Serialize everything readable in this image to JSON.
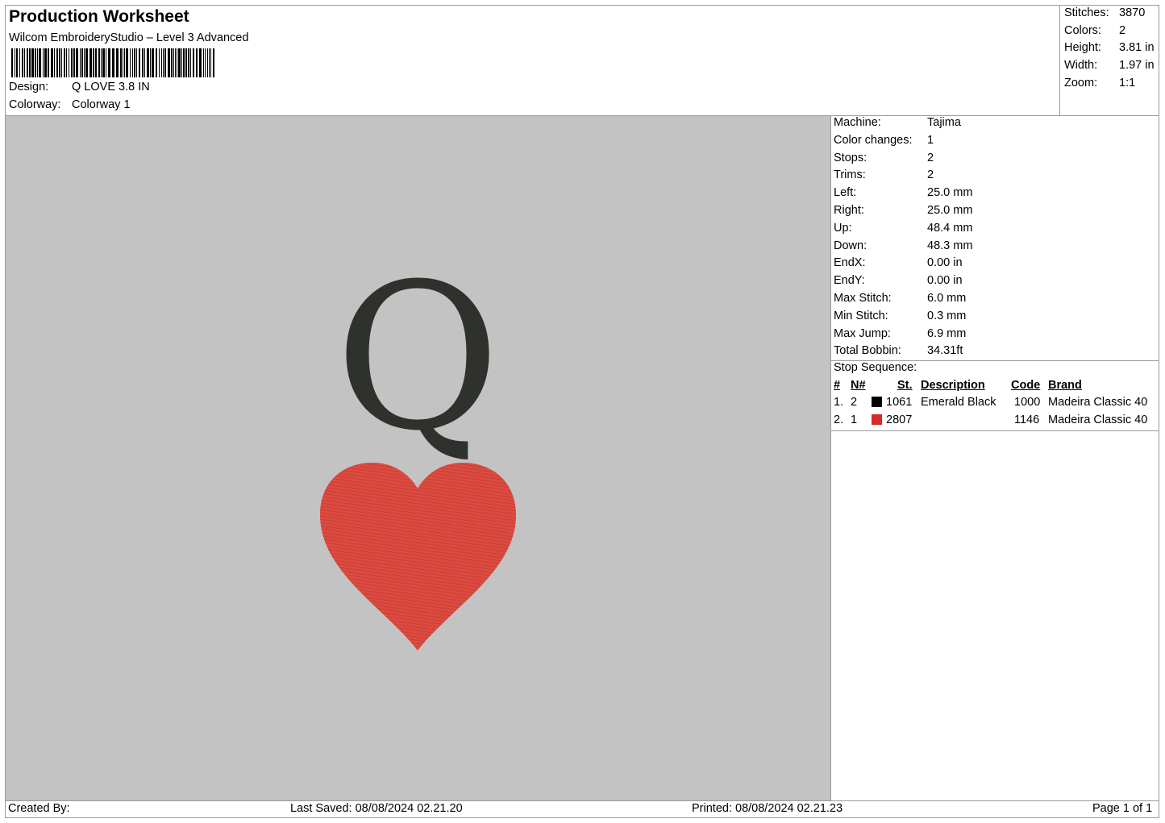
{
  "header": {
    "title": "Production Worksheet",
    "software": "Wilcom EmbroideryStudio – Level 3 Advanced",
    "design_label": "Design:",
    "design_value": "Q LOVE 3.8 IN",
    "colorway_label": "Colorway:",
    "colorway_value": "Colorway 1"
  },
  "summary": [
    {
      "label": "Stitches:",
      "value": "3870"
    },
    {
      "label": "Colors:",
      "value": "2"
    },
    {
      "label": "Height:",
      "value": "3.81 in"
    },
    {
      "label": "Width:",
      "value": "1.97 in"
    },
    {
      "label": "Zoom:",
      "value": "1:1"
    }
  ],
  "details": [
    {
      "label": "Machine:",
      "value": "Tajima"
    },
    {
      "label": "Color changes:",
      "value": "1"
    },
    {
      "label": "Stops:",
      "value": "2"
    },
    {
      "label": "Trims:",
      "value": "2"
    },
    {
      "label": "Left:",
      "value": "25.0 mm"
    },
    {
      "label": "Right:",
      "value": "25.0 mm"
    },
    {
      "label": "Up:",
      "value": "48.4 mm"
    },
    {
      "label": "Down:",
      "value": "48.3 mm"
    },
    {
      "label": "EndX:",
      "value": "0.00 in"
    },
    {
      "label": "EndY:",
      "value": "0.00 in"
    },
    {
      "label": "Max Stitch:",
      "value": "6.0 mm"
    },
    {
      "label": "Min Stitch:",
      "value": "0.3 mm"
    },
    {
      "label": "Max Jump:",
      "value": "6.9 mm"
    },
    {
      "label": "Total Bobbin:",
      "value": "34.31ft"
    }
  ],
  "stop_sequence": {
    "label": "Stop Sequence:",
    "columns": {
      "num": "#",
      "n": "N#",
      "st": "St.",
      "description": "Description",
      "code": "Code",
      "brand": "Brand"
    },
    "rows": [
      {
        "num": "1.",
        "n": "2",
        "color": "#000000",
        "st": "1061",
        "description": "Emerald Black",
        "code": "1000",
        "brand": "Madeira Classic 40"
      },
      {
        "num": "2.",
        "n": "1",
        "color": "#d42a2a",
        "st": "2807",
        "description": "",
        "code": "1146",
        "brand": "Madeira Classic 40"
      }
    ]
  },
  "design_preview": {
    "background": "#c3c3c3",
    "letter": "Q",
    "letter_color": "#2f312c",
    "heart_color": "#de4a40"
  },
  "footer": {
    "created_by": "Created By:",
    "last_saved": "Last Saved: 08/08/2024 02.21.20",
    "printed": "Printed: 08/08/2024 02.21.23",
    "page": "Page 1 of 1"
  }
}
